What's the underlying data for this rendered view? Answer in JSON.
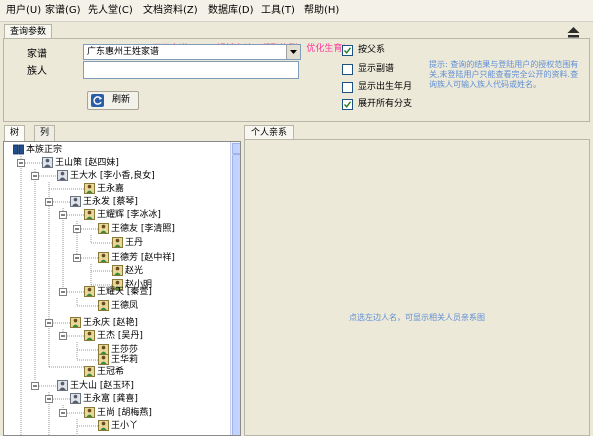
{
  "menu": [
    {
      "label": "用户(U)"
    },
    {
      "label": "家谱(G)"
    },
    {
      "label": "先人堂(C)"
    },
    {
      "label": "文档资料(Z)"
    },
    {
      "label": "数据库(D)"
    },
    {
      "label": "工具(T)"
    },
    {
      "label": "帮助(H)"
    }
  ],
  "query": {
    "title": "查询参数",
    "slogan": "天下家谱 ==> 解析亲疏，凝聚族群，优化生育!",
    "genealogy_label": "家谱",
    "genealogy_value": "广东惠州王姓家谱",
    "member_label": "族人",
    "member_value": "",
    "refresh_label": "刷新",
    "checkboxes": [
      {
        "label": "按父系",
        "checked": true
      },
      {
        "label": "显示副谱",
        "checked": false
      },
      {
        "label": "显示出生年月",
        "checked": false
      },
      {
        "label": "展开所有分支",
        "checked": true
      }
    ],
    "hint": "提示: 查询的结果与登陆用户的授权范围有关,未登陆用户只能查看完全公开的资料.查询族人可输入族人代码或姓名。"
  },
  "tabs": [
    {
      "label": "树状",
      "active": true
    },
    {
      "label": "列表",
      "active": false
    }
  ],
  "tree": {
    "root": "本族正宗",
    "nodes": [
      {
        "label": "王山策 [赵四妹]",
        "icon": "couple"
      },
      {
        "label": "王大水 [李小香,良女]",
        "icon": "couple"
      },
      {
        "label": "王永嘉",
        "icon": "person"
      },
      {
        "label": "王永发 [蔡琴]",
        "icon": "couple"
      },
      {
        "label": "王耀辉 [李冰冰]",
        "icon": "couple"
      },
      {
        "label": "王德友 [李清照]",
        "icon": "couple"
      },
      {
        "label": "王丹",
        "icon": "person"
      },
      {
        "label": "王德芳 [赵中祥]",
        "icon": "couple"
      },
      {
        "label": "赵光",
        "icon": "person"
      },
      {
        "label": "赵小明",
        "icon": "person"
      },
      {
        "label": "王耀天 [秦萱]",
        "icon": "couple"
      },
      {
        "label": "王德凤",
        "icon": "person"
      },
      {
        "label": "王永庆 [赵艳]",
        "icon": "couple"
      },
      {
        "label": "王杰 [吴丹]",
        "icon": "couple"
      },
      {
        "label": "王莎莎",
        "icon": "person"
      },
      {
        "label": "王华莉",
        "icon": "person"
      },
      {
        "label": "王冠希",
        "icon": "person"
      },
      {
        "label": "王大山 [赵玉环]",
        "icon": "couple"
      },
      {
        "label": "王永富 [龚喜]",
        "icon": "couple"
      },
      {
        "label": "王尚 [胡梅燕]",
        "icon": "couple"
      },
      {
        "label": "王小丫",
        "icon": "person"
      }
    ]
  },
  "right": {
    "title": "个人亲系",
    "hint": "点选左边人名，可显示相关人员亲系图"
  },
  "colors": {
    "slogan": "#ff3399",
    "hint": "#5f8fd6",
    "window_bg": "#ece9d8",
    "tree_bg": "#ffffff"
  },
  "icons": {
    "couple": "couple-icon",
    "person": "person-icon",
    "root": "book-icon",
    "refresh": "refresh-icon",
    "collapse_panel": "eject-icon"
  }
}
